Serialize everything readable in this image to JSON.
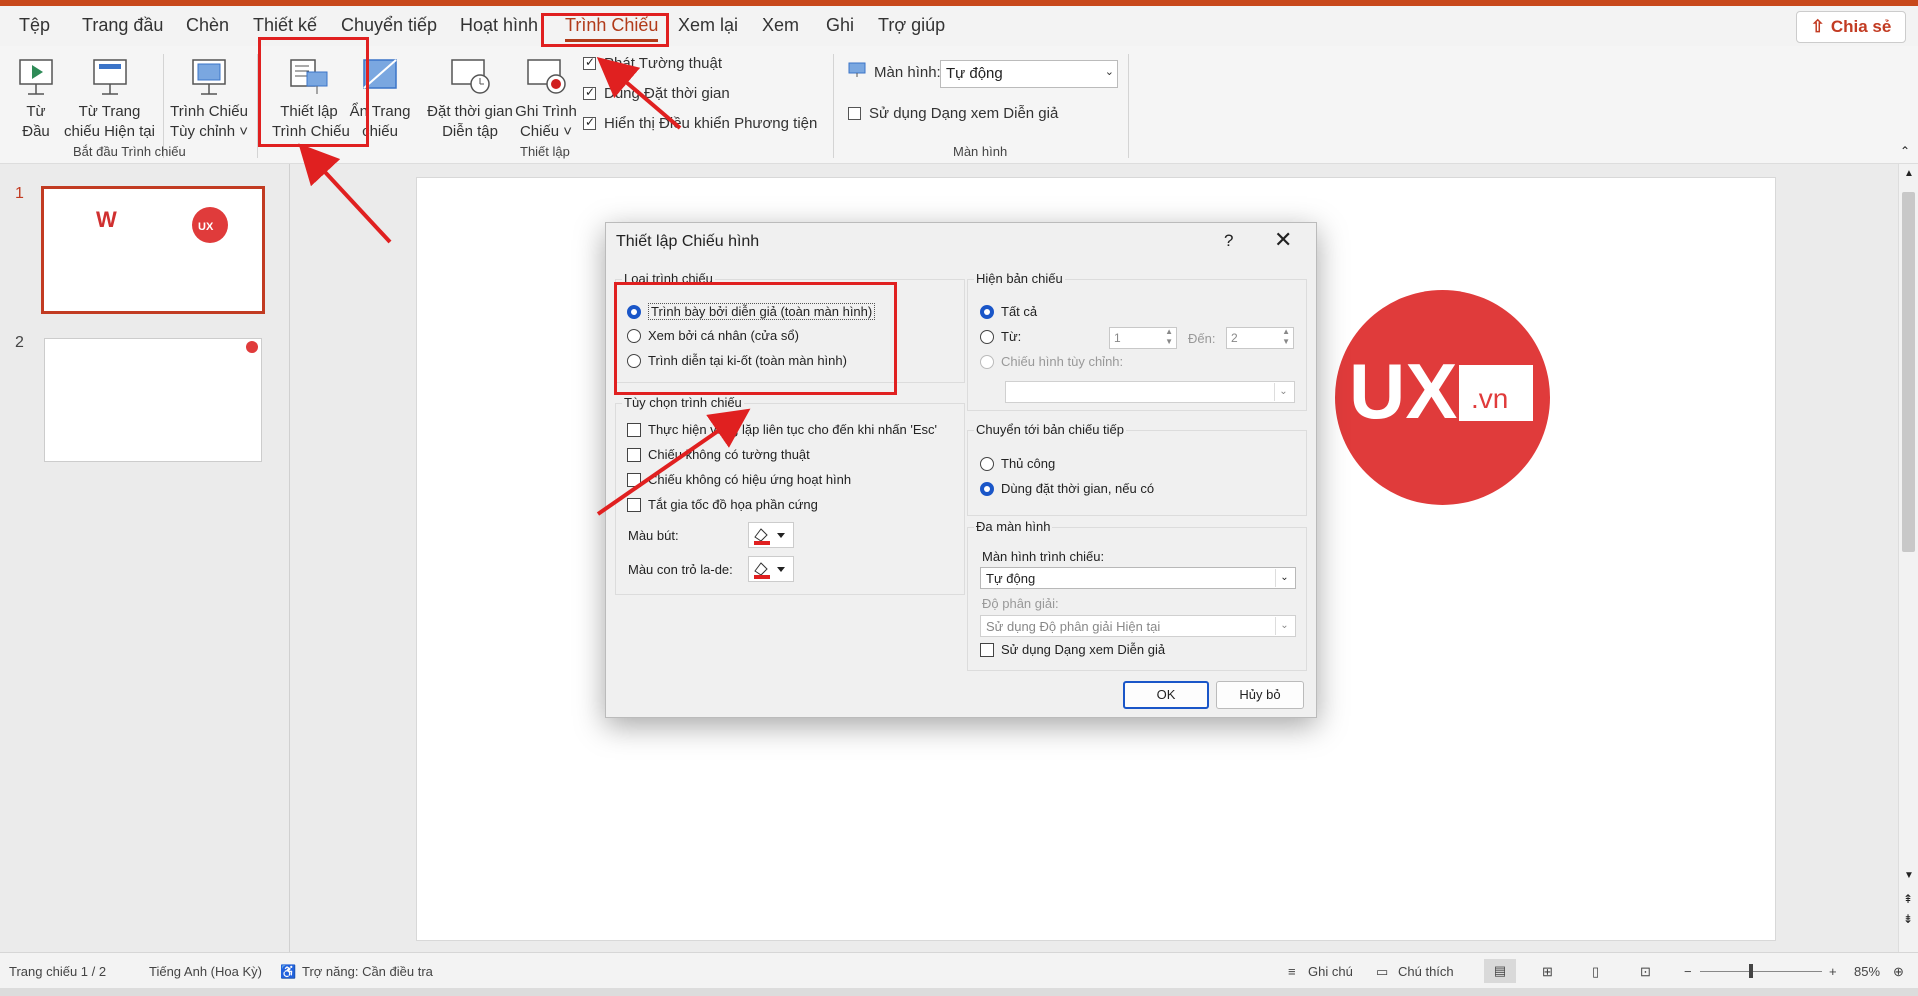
{
  "menu": {
    "items": [
      "Tệp",
      "Trang đầu",
      "Chèn",
      "Thiết kế",
      "Chuyển tiếp",
      "Hoạt hình",
      "Trình Chiếu",
      "Xem lại",
      "Xem",
      "Ghi",
      "Trợ giúp"
    ],
    "share": "Chia sẻ"
  },
  "ribbon": {
    "from_start": [
      "Từ",
      "Đầu"
    ],
    "from_current": [
      "Từ Trang",
      "chiếu Hiện tại"
    ],
    "custom_show": [
      "Trình Chiếu",
      "Tùy chỉnh ˅"
    ],
    "group_start": "Bắt đầu Trình chiếu",
    "setup_show": [
      "Thiết lập",
      "Trình Chiếu"
    ],
    "hide_slide": [
      "Ẩn Trang",
      "chiếu"
    ],
    "rehearse": [
      "Đặt thời gian",
      "Diễn tập"
    ],
    "record": [
      "Ghi Trình",
      "Chiếu ˅"
    ],
    "play_narration": "Phát Tường thuật",
    "use_timings": "Dùng Đặt thời gian",
    "show_media": "Hiển thị Điều khiển Phương tiện",
    "group_setup": "Thiết lập",
    "monitor_label": "Màn hình:",
    "monitor_value": "Tự động",
    "presenter_view": "Sử dụng Dạng xem Diễn giả",
    "group_monitors": "Màn hình"
  },
  "slides": {
    "numbers": [
      "1",
      "2"
    ]
  },
  "slide_logo": {
    "ux": "UX",
    ".vn": ".vn"
  },
  "dialog": {
    "title": "Thiết lập Chiếu hình",
    "help": "?",
    "close": "✕",
    "show_type": {
      "legend": "Loại trình chiếu",
      "options": [
        "Trình bày bởi diễn giả (toàn màn hình)",
        "Xem bởi cá nhân (cửa sổ)",
        "Trình diễn tại ki-ốt (toàn màn hình)"
      ]
    },
    "show_options": {
      "legend": "Tùy chọn trình chiếu",
      "options": [
        "Thực hiện vòng lặp liên tục cho đến khi nhấn 'Esc'",
        "Chiếu không có tường thuật",
        "Chiếu không có hiệu ứng hoạt hình",
        "Tắt gia tốc đồ họa phần cứng"
      ],
      "pen_color": "Màu bút:",
      "laser_color": "Màu con trỏ la-de:"
    },
    "show_slides": {
      "legend": "Hiện bản chiếu",
      "all": "Tất cả",
      "from": "Từ:",
      "from_value": "1",
      "to": "Đến:",
      "to_value": "2",
      "custom": "Chiếu hình tùy chỉnh:"
    },
    "advance": {
      "legend": "Chuyển tới bản chiếu tiếp",
      "manual": "Thủ công",
      "timings": "Dùng đặt thời gian, nếu có"
    },
    "multi_monitor": {
      "legend": "Đa màn hình",
      "monitor_label": "Màn hình trình chiếu:",
      "monitor_value": "Tự động",
      "resolution_label": "Độ phân giải:",
      "resolution_value": "Sử dụng Độ phân giải Hiện tại",
      "presenter_view": "Sử dụng Dạng xem Diễn giả"
    },
    "ok": "OK",
    "cancel": "Hủy bỏ"
  },
  "status": {
    "slide_count": "Trang chiếu 1 / 2",
    "language": "Tiếng Anh (Hoa Kỳ)",
    "accessibility": "Trợ năng: Cần điều tra",
    "notes": "Ghi chú",
    "comments": "Chú thích",
    "zoom": "85%",
    "minus": "−",
    "plus": "+"
  },
  "colors": {
    "accent": "#b13b1a",
    "annotation": "#e02020",
    "brand_logo": "#e03b3b",
    "selected_radio": "#1a56c8"
  }
}
